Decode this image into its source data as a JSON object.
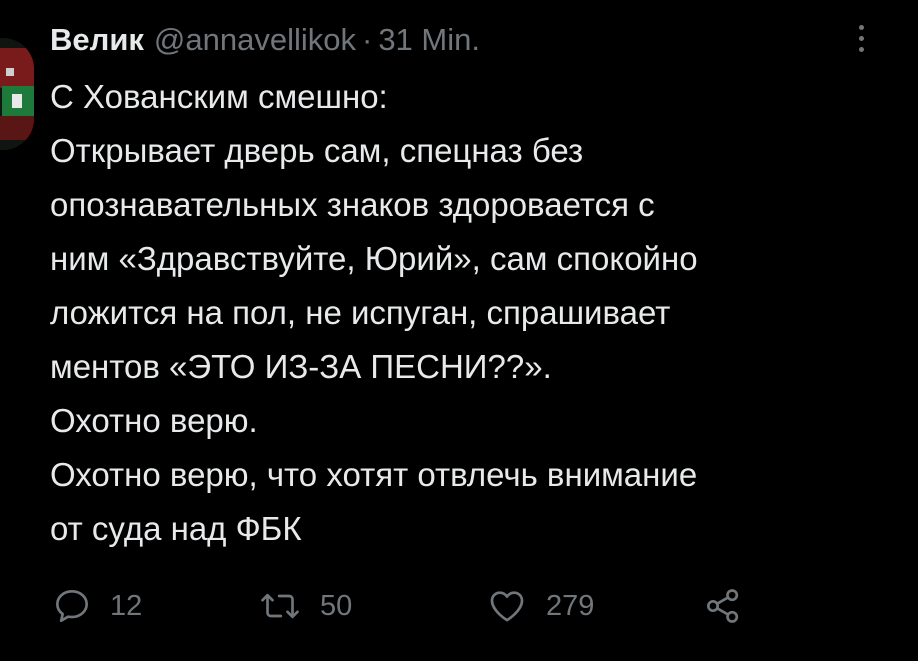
{
  "tweet": {
    "author": {
      "display_name": "Велик",
      "handle": "@annavellikok"
    },
    "separator": "·",
    "time": "31 Min.",
    "body_lines": [
      "С Хованским смешно:",
      "Открывает дверь сам, спецназ без",
      "опознавательных знаков здоровается с",
      "ним «Здравствуйте, Юрий», сам спокойно",
      "ложится на пол, не испуган, спрашивает",
      "ментов «ЭТО ИЗ-ЗА ПЕСНИ??».",
      "Охотно верю.",
      "Охотно верю, что хотят отвлечь внимание",
      "от суда над ФБК"
    ],
    "actions": {
      "reply": {
        "icon": "reply-icon",
        "count": "12"
      },
      "retweet": {
        "icon": "retweet-icon",
        "count": "50"
      },
      "like": {
        "icon": "heart-icon",
        "count": "279"
      },
      "share": {
        "icon": "share-icon"
      }
    },
    "more_icon": "more-vertical-icon"
  },
  "colors": {
    "background": "#000000",
    "text_primary": "#e7e9ea",
    "text_secondary": "#71767b"
  }
}
